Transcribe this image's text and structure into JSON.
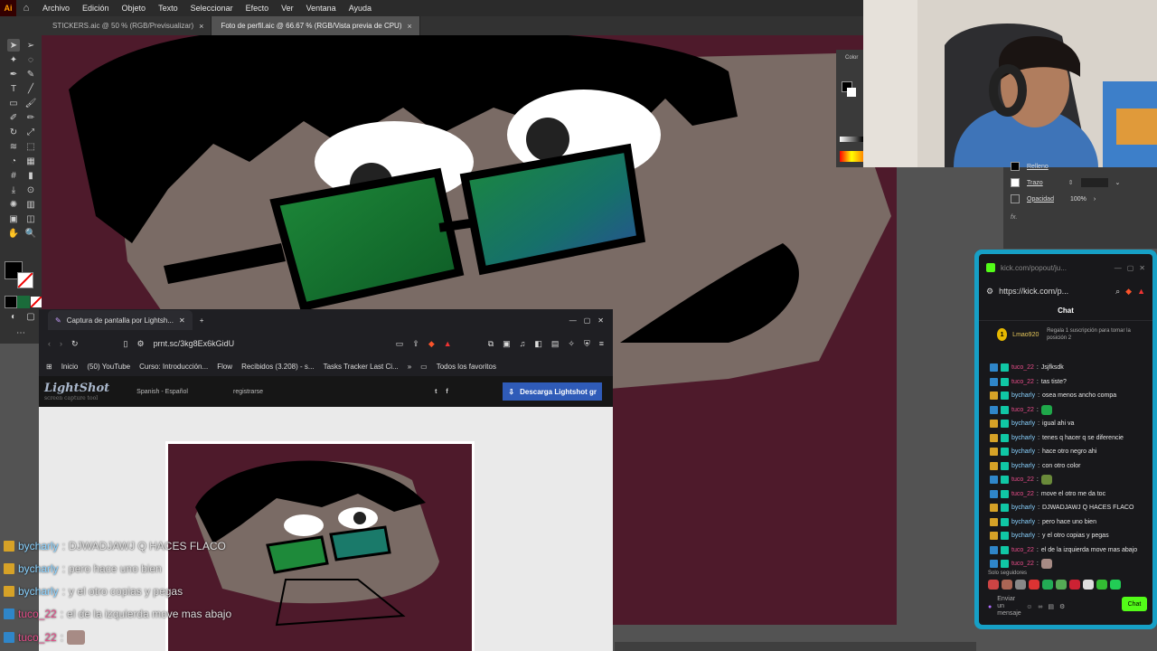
{
  "menubar": {
    "logo": "Ai",
    "items": [
      "Archivo",
      "Edición",
      "Objeto",
      "Texto",
      "Seleccionar",
      "Efecto",
      "Ver",
      "Ventana",
      "Ayuda"
    ]
  },
  "doc_tabs": [
    {
      "label": "STICKERS.aic @ 50 % (RGB/Previsualizar)",
      "active": false
    },
    {
      "label": "Foto de perfil.aic @ 66.67 % (RGB/Vista previa de CPU)",
      "active": true
    }
  ],
  "color_panel": {
    "label": "Color"
  },
  "props_panel": {
    "stroke_label": "Trazo",
    "opacity_label": "Opacidad",
    "opacity_value": "100%",
    "fx_label": "fx.",
    "top_label": "Relleno"
  },
  "kick": {
    "window_title": "kick.com/popout/ju...",
    "url": "https://kick.com/p...",
    "chat_title": "Chat",
    "gift_user": "Lmao920",
    "gift_count": "1",
    "gift_text": "Regala 1 suscripción para tomar la posición 2",
    "messages": [
      {
        "user": "tuco_22",
        "type": "tuco",
        "text": "Jsjfksdk"
      },
      {
        "user": "tuco_22",
        "type": "tuco",
        "text": "tas tiste?"
      },
      {
        "user": "bycharly",
        "type": "by",
        "text": "osea menos ancho compa"
      },
      {
        "user": "tuco_22",
        "type": "tuco",
        "text": "",
        "emote": "#1fa84a"
      },
      {
        "user": "bycharly",
        "type": "by",
        "text": "igual ahi va"
      },
      {
        "user": "bycharly",
        "type": "by",
        "text": "tenes q hacer q se diferencie"
      },
      {
        "user": "bycharly",
        "type": "by",
        "text": "hace otro negro ahi"
      },
      {
        "user": "bycharly",
        "type": "by",
        "text": "con otro color"
      },
      {
        "user": "tuco_22",
        "type": "tuco",
        "text": "",
        "emote": "#6a8a3a"
      },
      {
        "user": "tuco_22",
        "type": "tuco",
        "text": "move el otro me da toc"
      },
      {
        "user": "bycharly",
        "type": "by",
        "text": "DJWADJAWJ Q HACES FLACO"
      },
      {
        "user": "bycharly",
        "type": "by",
        "text": "pero hace uno bien"
      },
      {
        "user": "bycharly",
        "type": "by",
        "text": "y el otro copias y pegas"
      },
      {
        "user": "tuco_22",
        "type": "tuco",
        "text": "el de la izquierda move mas abajo"
      },
      {
        "user": "tuco_22",
        "type": "tuco",
        "text": "",
        "emote": "#a78b85"
      }
    ],
    "followers_only": "Solo seguidores",
    "input_placeholder": "Enviar un mensaje",
    "chat_button": "Chat"
  },
  "browser": {
    "tab_title": "Captura de pantalla por Lightsh...",
    "url": "prnt.sc/3kg8Ex6kGidU",
    "bookmarks": [
      "Inicio",
      "(50) YouTube",
      "Curso: Introducción...",
      "Flow",
      "Recibidos (3.208) - s...",
      "Tasks Tracker Last Ci..."
    ],
    "all_favs": "Todos los favoritos",
    "lightshot": {
      "logo": "LightShot",
      "logo_sub": "screen capture tool",
      "language": "Spanish - Español",
      "register": "registrarse",
      "twitter": "t",
      "facebook": "f",
      "download": "Descarga Lightshot gr"
    }
  },
  "overlay_chat": [
    {
      "user": "bycharly",
      "text": "DJWADJAWJ Q HACES FLACO",
      "type": "by"
    },
    {
      "user": "bycharly",
      "text": "pero hace uno bien",
      "type": "by"
    },
    {
      "user": "bycharly",
      "text": "y el otro copias y pegas",
      "type": "by"
    },
    {
      "user": "tuco_22",
      "text": "el de la izquierda move mas abajo",
      "type": "tuco"
    },
    {
      "user": "tuco_22",
      "text": "",
      "type": "tuco"
    }
  ],
  "colors": {
    "canvas_bg": "#4e1a2b",
    "kick_border": "#16a0c6",
    "kick_green": "#53fc18",
    "ls_blue": "#2f5bb8"
  }
}
